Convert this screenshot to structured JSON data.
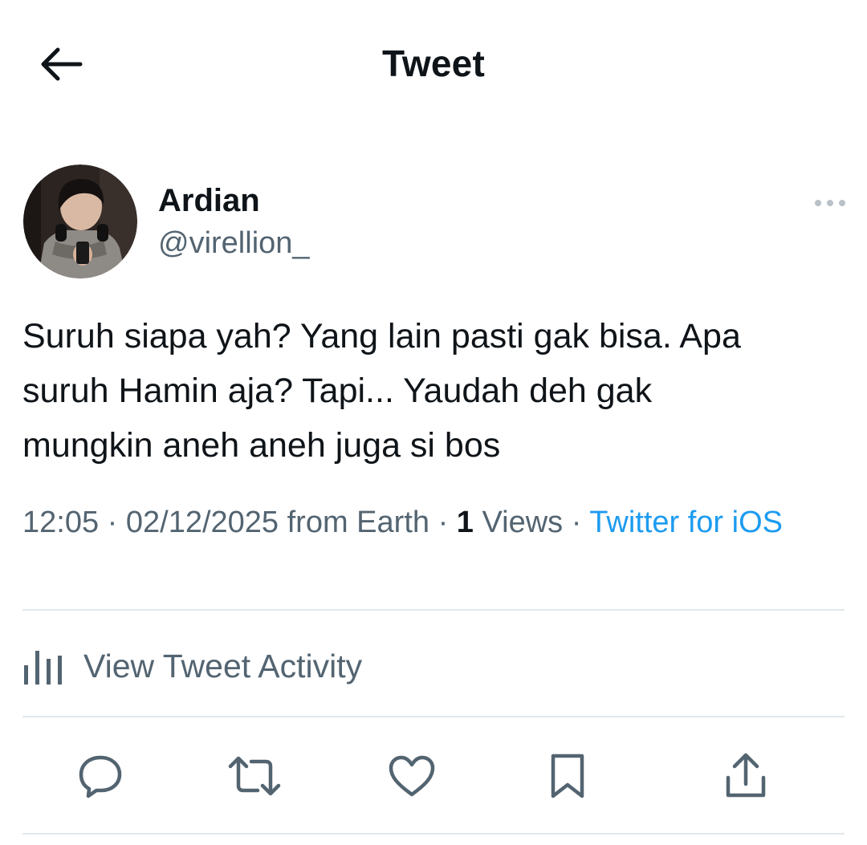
{
  "header": {
    "title": "Tweet",
    "back_icon": "arrow-left-icon"
  },
  "author": {
    "name": "Ardian",
    "handle": "@virellion_",
    "avatar_icon": "profile-photo"
  },
  "tweet": {
    "text_lines": [
      "Suruh siapa yah? Yang lain pasti gak bisa. Apa",
      "suruh Hamin aja? Tapi... Yaudah deh gak",
      "mungkin aneh aneh juga si bos"
    ]
  },
  "meta": {
    "time": "12:05",
    "date": "02/12/2025",
    "location": "from Earth",
    "separator": "·",
    "views_count": "1",
    "views_label": "Views",
    "client": "Twitter for iOS"
  },
  "activity": {
    "label": "View Tweet Activity",
    "icon": "bar-chart-icon"
  },
  "actions": [
    {
      "name": "reply",
      "icon": "reply-icon"
    },
    {
      "name": "retweet",
      "icon": "retweet-icon"
    },
    {
      "name": "like",
      "icon": "heart-icon"
    },
    {
      "name": "bookmark",
      "icon": "bookmark-icon"
    },
    {
      "name": "share",
      "icon": "share-icon"
    }
  ],
  "colors": {
    "text_primary": "#0f1419",
    "text_secondary": "#536471",
    "link": "#1d9bf0",
    "divider": "#e1e8ed"
  }
}
